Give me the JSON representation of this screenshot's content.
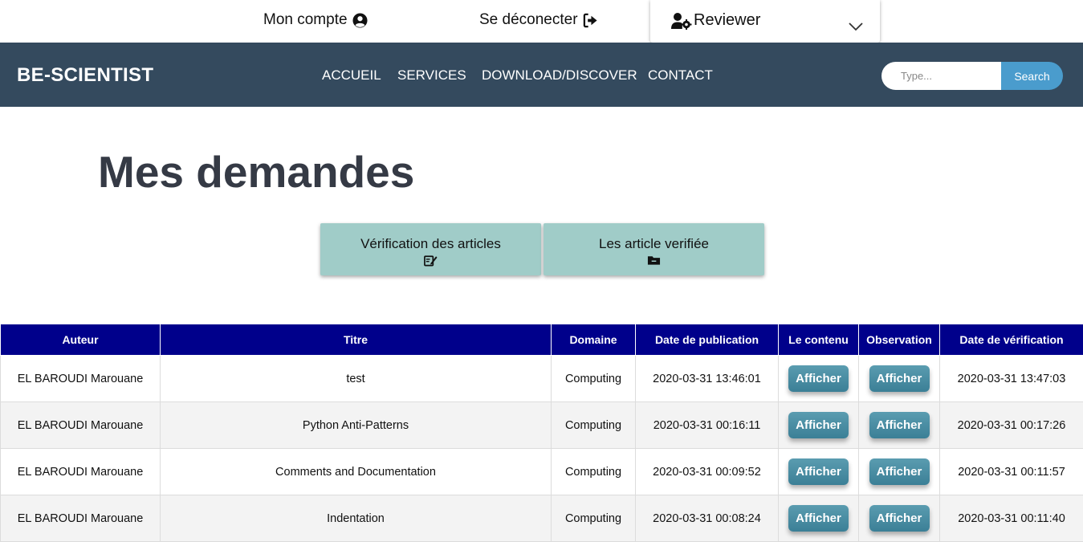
{
  "topbar": {
    "account_label": "Mon compte",
    "logout_label": "Se déconecter",
    "role_label": "Reviewer"
  },
  "navbar": {
    "brand": "BE-SCIENTIST",
    "items": [
      "ACCUEIL",
      "SERVICES",
      "DOWNLOAD/DISCOVER",
      "CONTACT"
    ],
    "search_placeholder": "Type...",
    "search_button": "Search"
  },
  "page_title": "Mes demandes",
  "tabs": [
    {
      "label": "Vérification des articles",
      "icon": "edit-document-icon"
    },
    {
      "label": "Les article verifiée",
      "icon": "folder-icon"
    }
  ],
  "table": {
    "headers": [
      "Auteur",
      "Titre",
      "Domaine",
      "Date de publication",
      "Le contenu",
      "Observation",
      "Date de vérification"
    ],
    "button_label": "Afficher",
    "rows": [
      {
        "auteur": "EL BAROUDI Marouane",
        "titre": "test",
        "domaine": "Computing",
        "date_pub": "2020-03-31 13:46:01",
        "date_verif": "2020-03-31 13:47:03"
      },
      {
        "auteur": "EL BAROUDI Marouane",
        "titre": "Python Anti-Patterns",
        "domaine": "Computing",
        "date_pub": "2020-03-31 00:16:11",
        "date_verif": "2020-03-31 00:17:26"
      },
      {
        "auteur": "EL BAROUDI Marouane",
        "titre": "Comments and Documentation",
        "domaine": "Computing",
        "date_pub": "2020-03-31 00:09:52",
        "date_verif": "2020-03-31 00:11:57"
      },
      {
        "auteur": "EL BAROUDI Marouane",
        "titre": "Indentation",
        "domaine": "Computing",
        "date_pub": "2020-03-31 00:08:24",
        "date_verif": "2020-03-31 00:11:40"
      }
    ]
  },
  "colors": {
    "navbar_bg": "#344a5e",
    "table_header_bg": "#00008b",
    "tab_bg": "#a0ccc8",
    "search_button_bg": "#4a9ccd",
    "action_button_bg": "#4a8ca2"
  }
}
